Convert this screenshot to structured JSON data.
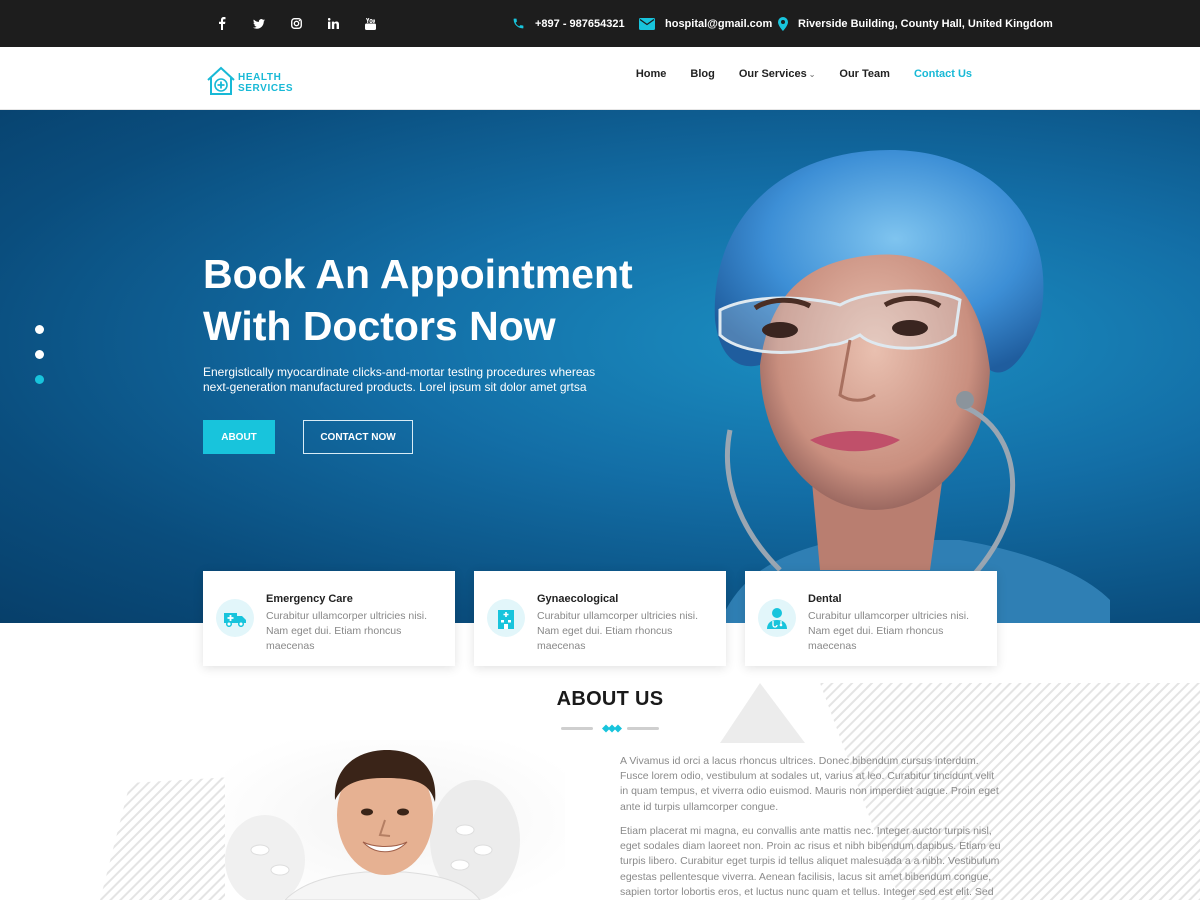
{
  "topbar": {
    "social": [
      {
        "name": "facebook-icon"
      },
      {
        "name": "twitter-icon"
      },
      {
        "name": "instagram-icon"
      },
      {
        "name": "linkedin-icon"
      },
      {
        "name": "youtube-icon"
      }
    ],
    "phone": "+897 - 987654321",
    "email": "hospital@gmail.com",
    "address": "Riverside Building, County Hall, United Kingdom"
  },
  "logo": {
    "line1": "HEALTH",
    "line2": "SERVICES"
  },
  "nav": {
    "home": "Home",
    "blog": "Blog",
    "services": "Our Services",
    "team": "Our Team",
    "contact": "Contact Us"
  },
  "hero": {
    "title_line1": "Book An Appointment",
    "title_line2": "With Doctors Now",
    "description": "Energistically myocardinate clicks-and-mortar testing procedures whereas next-generation manufactured products. Lorel ipsum sit dolor amet grtsa",
    "about_button": "ABOUT",
    "contact_button": "CONTACT NOW"
  },
  "cards": [
    {
      "title": "Emergency Care",
      "text": "Curabitur ullamcorper ultricies nisi. Nam eget dui. Etiam rhoncus maecenas"
    },
    {
      "title": "Gynaecological",
      "text": "Curabitur ullamcorper ultricies nisi. Nam eget dui. Etiam rhoncus maecenas"
    },
    {
      "title": "Dental",
      "text": "Curabitur ullamcorper ultricies nisi. Nam eget dui. Etiam rhoncus maecenas"
    }
  ],
  "about": {
    "title": "ABOUT US",
    "p1": "A Vivamus id orci a lacus rhoncus ultrices. Donec bibendum cursus interdum. Fusce lorem odio, vestibulum at sodales ut, varius at leo. Curabitur tincidunt velit in quam tempus, et viverra odio euismod. Mauris non imperdiet augue. Proin eget ante id turpis ullamcorper congue.",
    "p2": "Etiam placerat mi magna, eu convallis ante mattis nec. Integer auctor turpis nisl, eget sodales diam laoreet non. Proin ac risus et nibh bibendum dapibus. Etiam eu turpis libero. Curabitur eget turpis id tellus aliquet malesuada a a nibh. Vestibulum egestas pellentesque viverra. Aenean facilisis, lacus sit amet bibendum congue, sapien tortor lobortis eros, et luctus nunc quam et tellus. Integer sed est elit. Sed rhoncus lacinia"
  },
  "colors": {
    "accent": "#18c4dc",
    "topbar": "#1d1d1d",
    "hero_dark": "#0a4d7d"
  }
}
